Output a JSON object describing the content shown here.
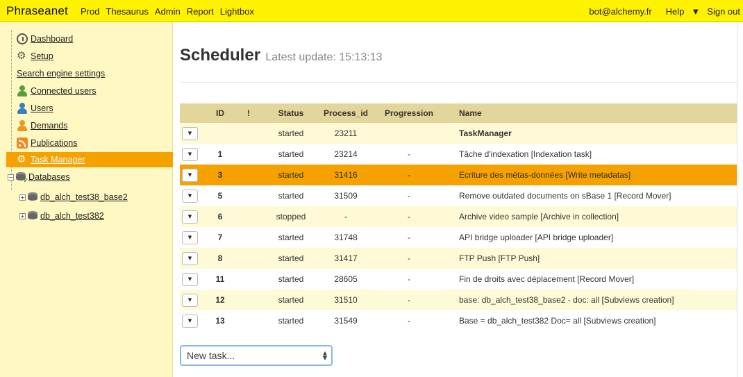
{
  "topbar": {
    "brand": "Phraseanet",
    "nav": [
      "Prod",
      "Thesaurus",
      "Admin",
      "Report",
      "Lightbox"
    ],
    "user": "bot@alchemy.fr",
    "help": "Help",
    "signout": "Sign out"
  },
  "sidebar": {
    "items": [
      {
        "label": "Dashboard",
        "icon": "dashboard-icon"
      },
      {
        "label": "Setup",
        "icon": "gears-icon"
      },
      {
        "label": "Search engine settings",
        "icon": ""
      },
      {
        "label": "Connected users",
        "icon": "user-green-icon"
      },
      {
        "label": "Users",
        "icon": "user-blue-icon"
      },
      {
        "label": "Demands",
        "icon": "user-orange-icon"
      },
      {
        "label": "Publications",
        "icon": "rss-icon"
      },
      {
        "label": "Task Manager",
        "icon": "cog-icon"
      },
      {
        "label": "Databases",
        "icon": "database-icon"
      }
    ],
    "databases": [
      "db_alch_test38_base2",
      "db_alch_test382"
    ]
  },
  "main": {
    "title": "Scheduler",
    "subtitle": "Latest update: 15:13:13",
    "table": {
      "headers": [
        "ID",
        "!",
        "Status",
        "Process_id",
        "Progression",
        "Name"
      ],
      "rows": [
        {
          "id": "",
          "flag": "",
          "status": "started",
          "pid": "23211",
          "progress": "",
          "name": "TaskManager"
        },
        {
          "id": "1",
          "flag": "",
          "status": "started",
          "pid": "23214",
          "progress": "-",
          "name": "Tâche d'indexation [Indexation task]"
        },
        {
          "id": "3",
          "flag": "",
          "status": "started",
          "pid": "31416",
          "progress": "-",
          "name": "Ecriture des métas-données [Write metadatas]"
        },
        {
          "id": "5",
          "flag": "",
          "status": "started",
          "pid": "31509",
          "progress": "-",
          "name": "Remove outdated documents on sBase 1 [Record Mover]"
        },
        {
          "id": "6",
          "flag": "",
          "status": "stopped",
          "pid": "-",
          "progress": "-",
          "name": "Archive video sample [Archive in collection]"
        },
        {
          "id": "7",
          "flag": "",
          "status": "started",
          "pid": "31748",
          "progress": "-",
          "name": "API bridge uploader [API bridge uploader]"
        },
        {
          "id": "8",
          "flag": "",
          "status": "started",
          "pid": "31417",
          "progress": "-",
          "name": "FTP Push [FTP Push]"
        },
        {
          "id": "11",
          "flag": "",
          "status": "started",
          "pid": "28605",
          "progress": "-",
          "name": "Fin de droits avec déplacement [Record Mover]"
        },
        {
          "id": "12",
          "flag": "",
          "status": "started",
          "pid": "31510",
          "progress": "-",
          "name": "base: db_alch_test38_base2 - doc: all [Subviews creation]"
        },
        {
          "id": "13",
          "flag": "",
          "status": "started",
          "pid": "31549",
          "progress": "-",
          "name": "Base = db_alch_test382 Doc= all [Subviews creation]"
        }
      ]
    },
    "new_task_select": "New task..."
  },
  "colors": {
    "topbar": "#fff200",
    "sidebar": "#fff8c2",
    "active": "#f5a100",
    "table_header": "#e2d69a",
    "row_alt": "#fffad6"
  }
}
